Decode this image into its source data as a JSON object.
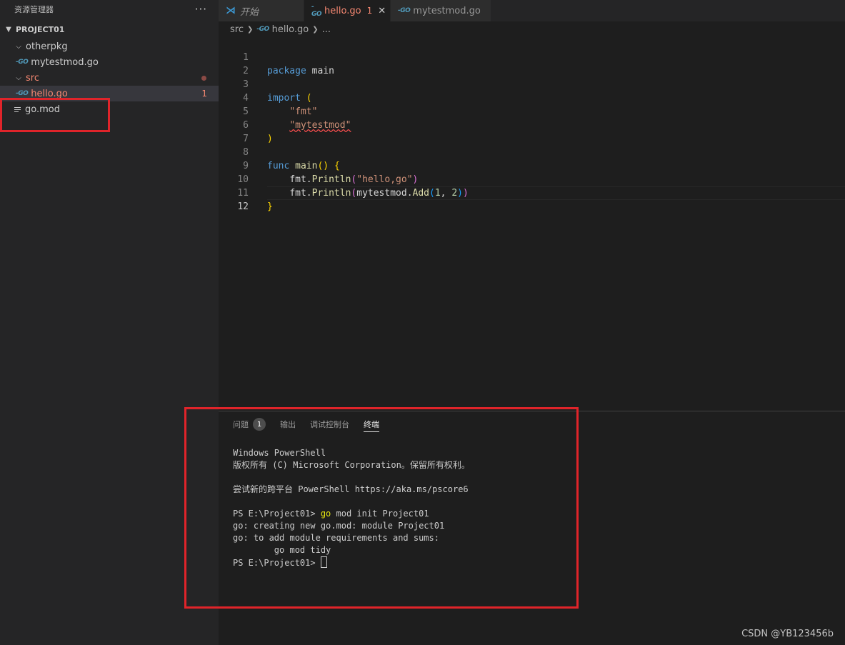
{
  "sidebar": {
    "header_title": "资源管理器",
    "more_label": "···",
    "section_title": "PROJECT01",
    "items": [
      {
        "label": "otherpkg",
        "type": "folder"
      },
      {
        "label": "mytestmod.go",
        "type": "go-file"
      },
      {
        "label": "src",
        "type": "folder"
      },
      {
        "label": "hello.go",
        "type": "go-file",
        "problems": "1",
        "selected": true
      },
      {
        "label": "go.mod",
        "type": "file"
      }
    ]
  },
  "tabs": [
    {
      "label": "开始",
      "icon": "vscode-icon"
    },
    {
      "label": "hello.go",
      "icon": "go-icon",
      "count": "1",
      "close": "✕",
      "active": true
    },
    {
      "label": "mytestmod.go",
      "icon": "go-icon"
    }
  ],
  "breadcrumb": {
    "folder": "src",
    "file": "hello.go",
    "more": "..."
  },
  "code": {
    "line_numbers": [
      "1",
      "2",
      "3",
      "4",
      "5",
      "6",
      "7",
      "8",
      "9",
      "10",
      "11",
      "12"
    ],
    "package_kw": "package",
    "package_name": "main",
    "import_kw": "import",
    "import_fmt": "\"fmt\"",
    "import_mytestmod": "\"mytestmod\"",
    "func_kw": "func",
    "func_name": "main",
    "println1_obj": "fmt.",
    "println1_fn": "Println",
    "println1_arg": "\"hello,go\"",
    "println2_obj": "fmt.",
    "println2_fn": "Println",
    "println2_pkg": "mytestmod.",
    "println2_fn2": "Add",
    "arg_a": "1",
    "arg_b": "2"
  },
  "panel": {
    "tabs": [
      {
        "label": "问题",
        "badge": "1"
      },
      {
        "label": "输出"
      },
      {
        "label": "调试控制台"
      },
      {
        "label": "终端",
        "active": true
      }
    ],
    "terminal": {
      "line1": "Windows PowerShell",
      "line2": "版权所有 (C) Microsoft Corporation。保留所有权利。",
      "line3": "",
      "line4": "尝试新的跨平台 PowerShell https://aka.ms/pscore6",
      "line5": "",
      "prompt1": "PS E:\\Project01> ",
      "cmd1_go": "go",
      "cmd1_rest": " mod init Project01",
      "line7": "go: creating new go.mod: module Project01",
      "line8": "go: to add module requirements and sums:",
      "line9": "        go mod tidy",
      "prompt2": "PS E:\\Project01> "
    }
  },
  "watermark": "CSDN @YB123456b",
  "colors": {
    "annotation": "#e0242a",
    "error": "#f48771",
    "go": "#519aba"
  }
}
